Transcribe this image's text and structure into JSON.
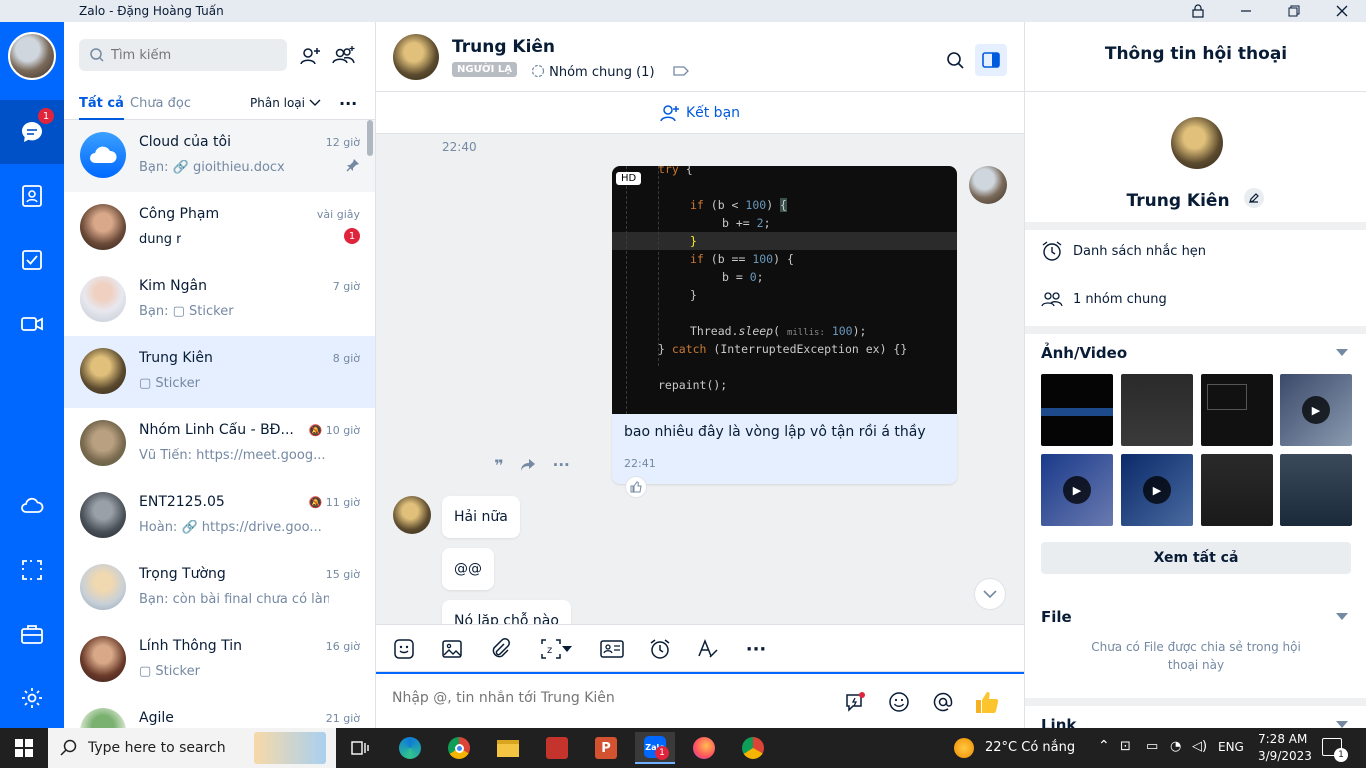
{
  "window": {
    "title": "Zalo - Đặng Hoàng Tuấn"
  },
  "nav": {
    "chat_badge": "1"
  },
  "list": {
    "search_placeholder": "Tìm kiếm",
    "tabs": [
      "Tất cả",
      "Chưa đọc"
    ],
    "classify": "Phân loại",
    "conversations": [
      {
        "name": "Cloud của tôi",
        "time": "12 giờ",
        "preview": "Bạn: 🔗 gioithieu.docx",
        "pinned": true
      },
      {
        "name": "Công Phạm",
        "time": "vài giây",
        "preview": "dung r",
        "badge": "1"
      },
      {
        "name": "Kim Ngân",
        "time": "7 giờ",
        "preview": "Bạn: ▢ Sticker"
      },
      {
        "name": "Trung Kiên",
        "time": "8 giờ",
        "preview": "▢ Sticker"
      },
      {
        "name": "Nhóm Linh Cẩu - BĐ...",
        "time": "10 giờ",
        "preview": "Vũ Tiến: https://meet.goog..."
      },
      {
        "name": "ENT2125.05",
        "time": "11 giờ",
        "preview": "Hoàn: 🔗 https://drive.goo..."
      },
      {
        "name": "Trọng Tường",
        "time": "15 giờ",
        "preview": "Bạn: còn bài final chưa có làm á"
      },
      {
        "name": "Lính Thông Tin",
        "time": "16 giờ",
        "preview": "▢ Sticker"
      },
      {
        "name": "Agile",
        "time": "21 giờ",
        "preview": ""
      }
    ]
  },
  "chat": {
    "name": "Trung Kiên",
    "stranger_badge": "NGƯỜI LẠ",
    "groups": "Nhóm chung (1)",
    "add_friend": "Kết bạn",
    "time_divider": "22:40",
    "hd": "HD",
    "code_lines": [
      {
        "t": "try {",
        "k": true
      },
      {
        "t": ""
      },
      {
        "t": "    if (b < 100) {"
      },
      {
        "t": "        b += 2;"
      },
      {
        "t": "    }"
      },
      {
        "t": "    if (b == 100) {"
      },
      {
        "t": "        b = 0;"
      },
      {
        "t": "    }"
      },
      {
        "t": ""
      },
      {
        "t": "    Thread.sleep( millis: 100);"
      },
      {
        "t": "} catch (InterruptedException ex) {}"
      },
      {
        "t": ""
      },
      {
        "t": "repaint();"
      }
    ],
    "my_message": "bao nhiêu đây là vòng lập vô tận rồi á thầy",
    "my_message_time": "22:41",
    "replies": [
      "Hải nữa",
      "@@",
      "Nó lặp chỗ nào"
    ],
    "input_placeholder": "Nhập @, tin nhắn tới Trung Kiên"
  },
  "info": {
    "title": "Thông tin hội thoại",
    "name": "Trung Kiên",
    "reminders": "Danh sách nhắc hẹn",
    "common_groups": "1 nhóm chung",
    "media_title": "Ảnh/Video",
    "see_all": "Xem tất cả",
    "file_title": "File",
    "no_file": "Chưa có File được chia sẻ trong hội thoại này",
    "link_title": "Link"
  },
  "taskbar": {
    "search": "Type here to search",
    "weather": "22°C  Có nắng",
    "lang": "ENG",
    "time": "7:28 AM",
    "date": "3/9/2023",
    "notif": "1",
    "zalo_badge": "1"
  }
}
